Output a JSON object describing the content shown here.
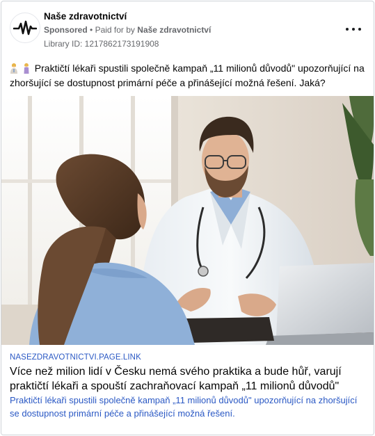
{
  "header": {
    "page_name": "Naše zdravotnictví",
    "sponsored": "Sponsored",
    "separator": "•",
    "paid_for_by_prefix": "Paid for by",
    "paid_for_by_name": "Naše zdravotnictví",
    "library_id": "Library ID: 1217862173191908",
    "avatar_icon": "heartbeat-pulse-icon",
    "more_icon": "more-options-icon"
  },
  "post": {
    "emojis": [
      "woman-health-worker-emoji",
      "woman-standing-emoji"
    ],
    "text": "Praktičtí lékaři spustili společně kampaň „11 milionů důvodů\" upozorňující na zhoršující se dostupnost primární péče a přinášející možná řešení. Jaká?"
  },
  "image": {
    "subject": "doctor-patient-consultation-photo"
  },
  "link": {
    "domain": "NASEZDRAVOTNICTVI.PAGE.LINK",
    "headline": "Více než milion lidí v Česku nemá svého praktika a bude hůř, varují praktičtí lékaři a spouští zachraňovací kampaň „11 milionů důvodů\"",
    "description": "Praktičtí lékaři spustili společně kampaň „11 milionů důvodů\" upozorňující na zhoršující se dostupnost primární péče a přinášející možná řešení."
  },
  "colors": {
    "link_blue": "#2a58c4",
    "meta_gray": "#65676b",
    "text_dark": "#050505"
  }
}
